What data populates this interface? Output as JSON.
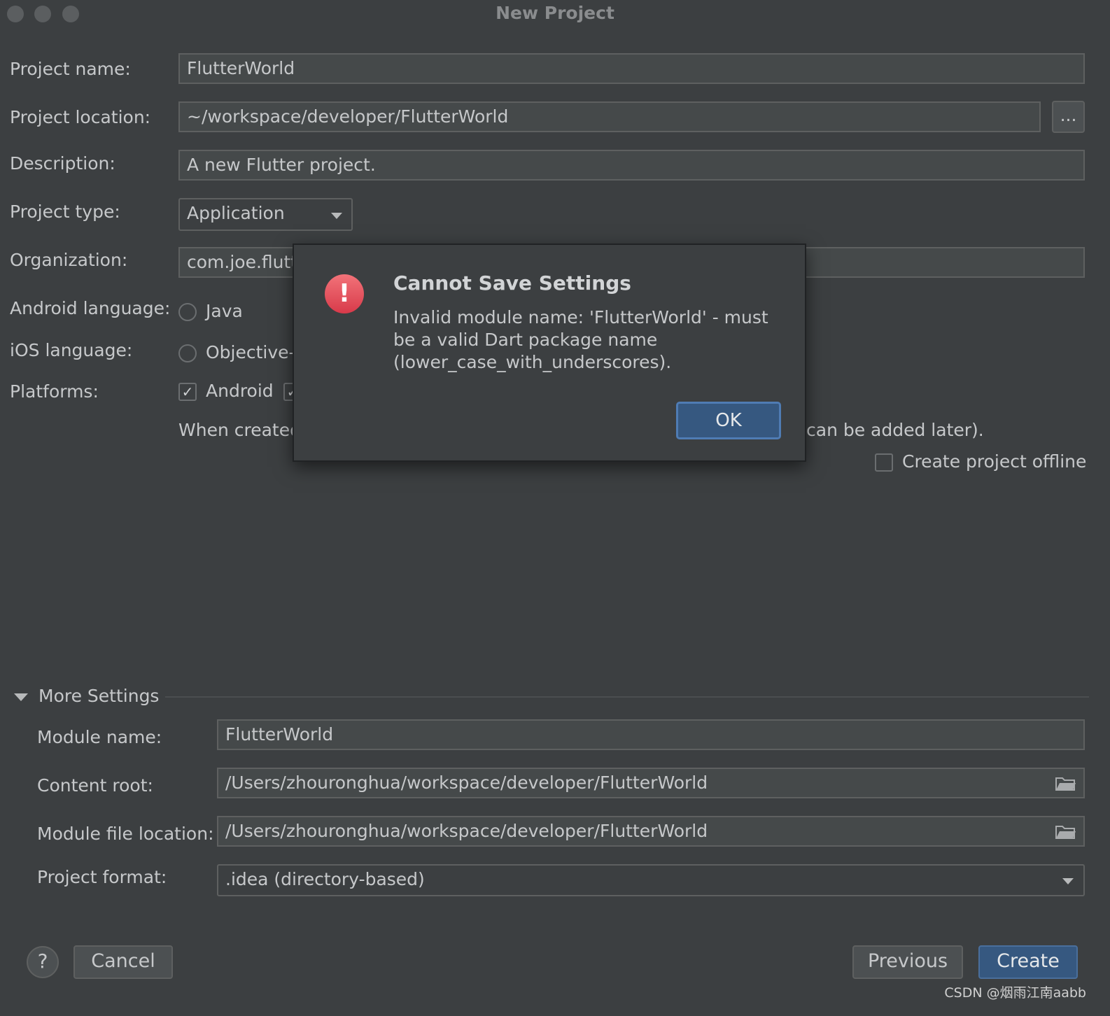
{
  "window": {
    "title": "New Project"
  },
  "form": {
    "project_name": {
      "label": "Project name:",
      "value": "FlutterWorld"
    },
    "project_location": {
      "label": "Project location:",
      "value": "~/workspace/developer/FlutterWorld",
      "browse_label": "..."
    },
    "description": {
      "label": "Description:",
      "value": "A new Flutter project."
    },
    "project_type": {
      "label": "Project type:",
      "value": "Application"
    },
    "organization": {
      "label": "Organization:",
      "value": "com.joe.flutt"
    },
    "android_language": {
      "label": "Android language:",
      "option": "Java"
    },
    "ios_language": {
      "label": "iOS language:",
      "option": "Objective-"
    },
    "platforms": {
      "label": "Platforms:",
      "android": "Android",
      "android_checked": true
    },
    "hint_left": "When created",
    "hint_right": "can be added later).",
    "create_offline": {
      "label": "Create project offline",
      "checked": false
    }
  },
  "more_settings": {
    "header": "More Settings",
    "module_name": {
      "label": "Module name:",
      "value": "FlutterWorld"
    },
    "content_root": {
      "label": "Content root:",
      "value": "/Users/zhouronghua/workspace/developer/FlutterWorld"
    },
    "module_file_location": {
      "label": "Module file location:",
      "value": "/Users/zhouronghua/workspace/developer/FlutterWorld"
    },
    "project_format": {
      "label": "Project format:",
      "value": ".idea (directory-based)"
    }
  },
  "footer": {
    "help_label": "?",
    "cancel_label": "Cancel",
    "previous_label": "Previous",
    "create_label": "Create"
  },
  "dialog": {
    "title": "Cannot Save Settings",
    "message": "Invalid module name: 'FlutterWorld' - must be a valid Dart package name (lower_case_with_underscores).",
    "icon": "error-icon",
    "ok_label": "OK"
  },
  "watermark": "CSDN @烟雨江南aabb",
  "colors": {
    "background": "#3c3f41",
    "field": "#45494a",
    "primary": "#365880",
    "error": "#e0505c"
  }
}
